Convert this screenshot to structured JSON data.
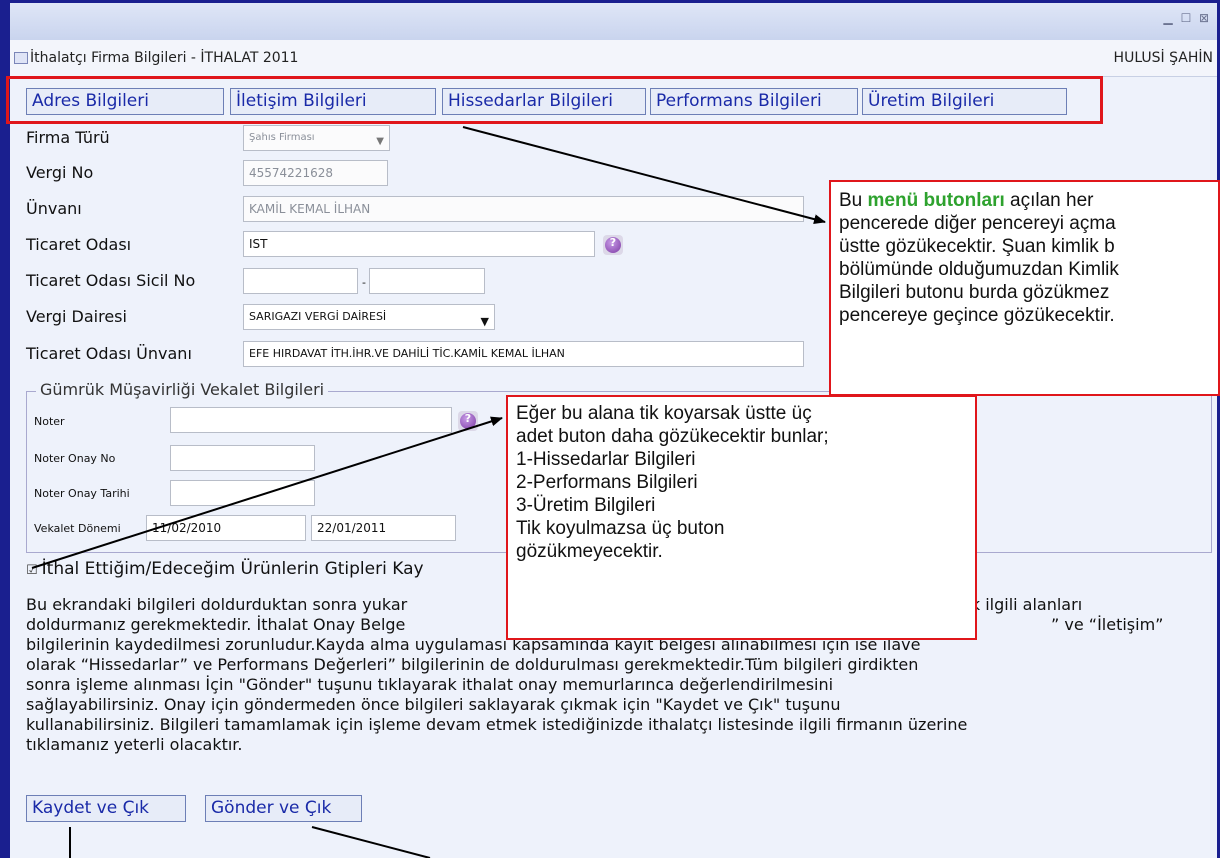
{
  "window": {
    "title": "İthalatçı Firma Bilgileri - İTHALAT 2011",
    "user": "HULUSİ ŞAHİN",
    "controls": [
      "minimize-icon",
      "maximize-icon",
      "close-icon"
    ]
  },
  "menu_tabs": [
    "Adres Bilgileri",
    "İletişim Bilgileri",
    "Hissedarlar Bilgileri",
    "Performans Bilgileri",
    "Üretim Bilgileri"
  ],
  "form": {
    "firma_turu": {
      "label": "Firma Türü",
      "value": "Şahıs Firması"
    },
    "vergi_no": {
      "label": "Vergi No",
      "value": "45574221628"
    },
    "unvani": {
      "label": "Ünvanı",
      "value": "KAMİL KEMAL İLHAN"
    },
    "ticaret_odasi": {
      "label": "Ticaret Odası",
      "value": "IST"
    },
    "sicil_no": {
      "label": "Ticaret Odası Sicil No",
      "value1": "",
      "sep": "-",
      "value2": ""
    },
    "vergi_dairesi": {
      "label": "Vergi Dairesi",
      "value": "SARIGAZI VERGİ DAİRESİ"
    },
    "oda_unvani": {
      "label": "Ticaret Odası Ünvanı",
      "value": "EFE HIRDAVAT İTH.İHR.VE DAHİLİ TİC.KAMİL KEMAL İLHAN"
    }
  },
  "vekalet": {
    "legend": "Gümrük Müşavirliği Vekalet Bilgileri",
    "noter": {
      "label": "Noter",
      "value": ""
    },
    "onay_no": {
      "label": "Noter Onay No",
      "value": ""
    },
    "onay_tarihi": {
      "label": "Noter Onay Tarihi",
      "value": ""
    },
    "donem": {
      "label": "Vekalet Dönemi",
      "start": "11/02/2010",
      "end": "22/01/2011"
    }
  },
  "checkbox": {
    "label": "İthal Ettiğim/Edeceğim Ürünlerin Gtipleri Kay",
    "checked": true
  },
  "instructions": {
    "line1": "Bu ekrandaki bilgileri doldurduktan sonra yukar",
    "line1_end": "ek ilgili alanları",
    "line2": "doldurmanız gerekmektedir. İthalat Onay Belge",
    "line2_end": "” ve “İletişim”",
    "line3": "bilgilerinin kaydedilmesi zorunludur.Kayda alma uygulaması kapsamında kayıt belgesi alınabilmesi için ise ilave",
    "line4": "olarak “Hissedarlar” ve Performans Değerleri” bilgilerinin de doldurulması gerekmektedir.Tüm bilgileri girdikten",
    "line5": "sonra işleme alınması İçin \"Gönder\" tuşunu tıklayarak ithalat onay memurlarınca değerlendirilmesini",
    "line6": "sağlayabilirsiniz. Onay için göndermeden önce bilgileri saklayarak çıkmak için \"Kaydet ve Çık\" tuşunu",
    "line7": "kullanabilirsiniz. Bilgileri tamamlamak için işleme devam etmek istediğinizde ithalatçı listesinde ilgili firmanın üzerine",
    "line8": "tıklamanız yeterli olacaktır."
  },
  "buttons": {
    "save": "Kaydet ve Çık",
    "send": "Gönder ve Çık"
  },
  "callouts": {
    "menu": {
      "prefix": "Bu ",
      "highlight": "menü butonları",
      "l1_rest": " açılan her",
      "l2": "pencerede diğer pencereyi açma",
      "l3": "üstte gözükecektir. Şuan kimlik b",
      "l4": "bölümünde olduğumuzdan Kimlik",
      "l5": "Bilgileri butonu burda gözükmez",
      "l6": "pencereye geçince gözükecektir."
    },
    "checkbox": {
      "l1": "Eğer bu alana tik koyarsak üstte üç",
      "l2": "adet buton daha gözükecektir bunlar;",
      "l3": "1-Hissedarlar Bilgileri",
      "l4": "2-Performans Bilgileri",
      "l5": "3-Üretim Bilgileri",
      "l6": "Tik koyulmazsa üç buton",
      "l7": "gözükmeyecektir."
    }
  },
  "colors": {
    "accent": "#1a2aa8",
    "callout_border": "#e0161b",
    "highlight": "#2ea22e",
    "frame": "#1a1f8f"
  }
}
